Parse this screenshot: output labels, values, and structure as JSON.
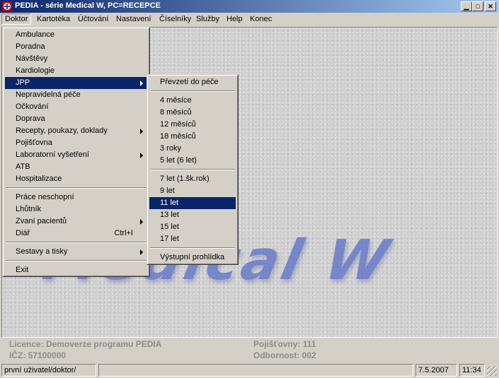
{
  "window": {
    "title": "PEDIA - série Medical W,  PC=RECEPCE"
  },
  "menubar": [
    "Doktor",
    "Kartotéka",
    "Účtování",
    "Nastavení",
    "Číselníky",
    "Služby",
    "Help",
    "Konec"
  ],
  "doktor_menu": {
    "items": [
      "Ambulance",
      "Poradna",
      "Návštěvy",
      "Kardiologie",
      "JPP",
      "Nepravidelná péče",
      "Očkování",
      "Doprava",
      "Recepty, poukazy, doklady",
      "Pojišťovna",
      "Laboratorní vyšetření",
      "ATB",
      "Hospitalizace",
      "Práce neschopní",
      "Lhůtník",
      "Zvaní pacientů",
      "Diář",
      "Sestavy a tisky",
      "Exit"
    ],
    "shortcut_diar": "Ctrl+I"
  },
  "jpp_menu": {
    "items": [
      "Převzetí do péče",
      "4 měsíce",
      "8 měsíců",
      "12 měsíců",
      "18 měsíců",
      "3 roky",
      "5 let (6 let)",
      "7 let (1.šk.rok)",
      "9 let",
      "11 let",
      "13 let",
      "15 let",
      "17 let",
      "Výstupní prohlídka"
    ]
  },
  "background_logo": "Medical W",
  "info": {
    "licence": "Licence: Demoverze programu PEDIA",
    "icz": "IČZ: 57100000",
    "pojistovny": "Pojišťovny: 111",
    "odbornost": "Odbornost: 002"
  },
  "status": {
    "user": "první uživatel/doktor/",
    "middle": "",
    "date": "7.5.2007",
    "time": "11:34"
  },
  "icons": {
    "app": "pedia-app-icon",
    "minimize": "minimize-icon",
    "maximize": "maximize-icon",
    "close": "close-icon"
  },
  "colors": {
    "highlight": "#0a246a",
    "titlebar": "#0a246a",
    "face": "#d4d0c8"
  }
}
